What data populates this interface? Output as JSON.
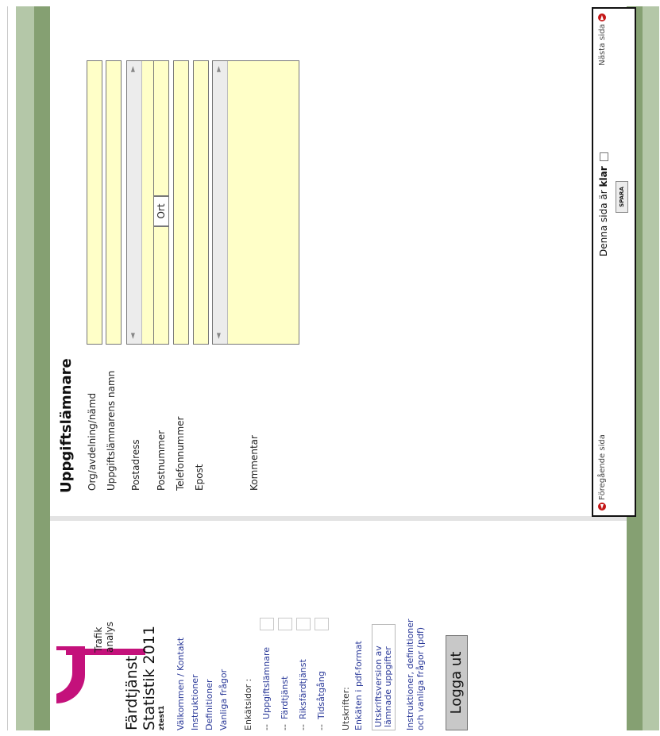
{
  "brand": {
    "line1": "Trafik",
    "line2": "analys"
  },
  "app": {
    "title_line1": "Färdtjänst",
    "title_line2": "Statistik 2011",
    "user": "ztest1"
  },
  "sidebar": {
    "links": [
      "Välkommen / Kontakt",
      "Instruktioner",
      "Definitioner",
      "Vanliga frågor"
    ],
    "enkat_heading": "Enkätsidor :",
    "enkat_items": [
      "Uppgiftslämnare",
      "Färdtjänst",
      "Riksfärdtjänst",
      "Tidsåtgång"
    ],
    "utskrifter_heading": "Utskrifter:",
    "pdf_link": "Enkäten i pdf-format",
    "print_version_line1": "Utskriftsversion av",
    "print_version_line2": "lämnade uppgifter",
    "instructions_pdf_line1": "Instruktioner, definitioner",
    "instructions_pdf_line2": "och vanliga frågor (pdf)",
    "logout": "Logga ut"
  },
  "form": {
    "heading": "Uppgiftslämnare",
    "labels": {
      "org": "Org/avdelning/nämd",
      "name": "Uppgiftslämnarens namn",
      "address": "Postadress",
      "postnummer": "Postnummer",
      "ort": "Ort",
      "telefon": "Telefonnummer",
      "epost": "Epost",
      "kommentar": "Kommentar"
    },
    "values": {
      "org": "",
      "name": "",
      "address": "",
      "postnummer": "",
      "ort": "",
      "telefon": "",
      "epost": "",
      "kommentar": ""
    }
  },
  "nav": {
    "prev": "Föregående sida",
    "next": "Nästa sida",
    "done_prefix": "Denna sida är",
    "done_bold": "klar",
    "save": "SPARA"
  },
  "colors": {
    "green_dark": "#85a072",
    "green_light": "#b4c7a8",
    "field": "#ffffc8",
    "logo": "#c4117b",
    "link": "#2b3a99"
  },
  "icons": {
    "prev": "arrow-left-circle-icon",
    "next": "arrow-right-circle-icon"
  }
}
